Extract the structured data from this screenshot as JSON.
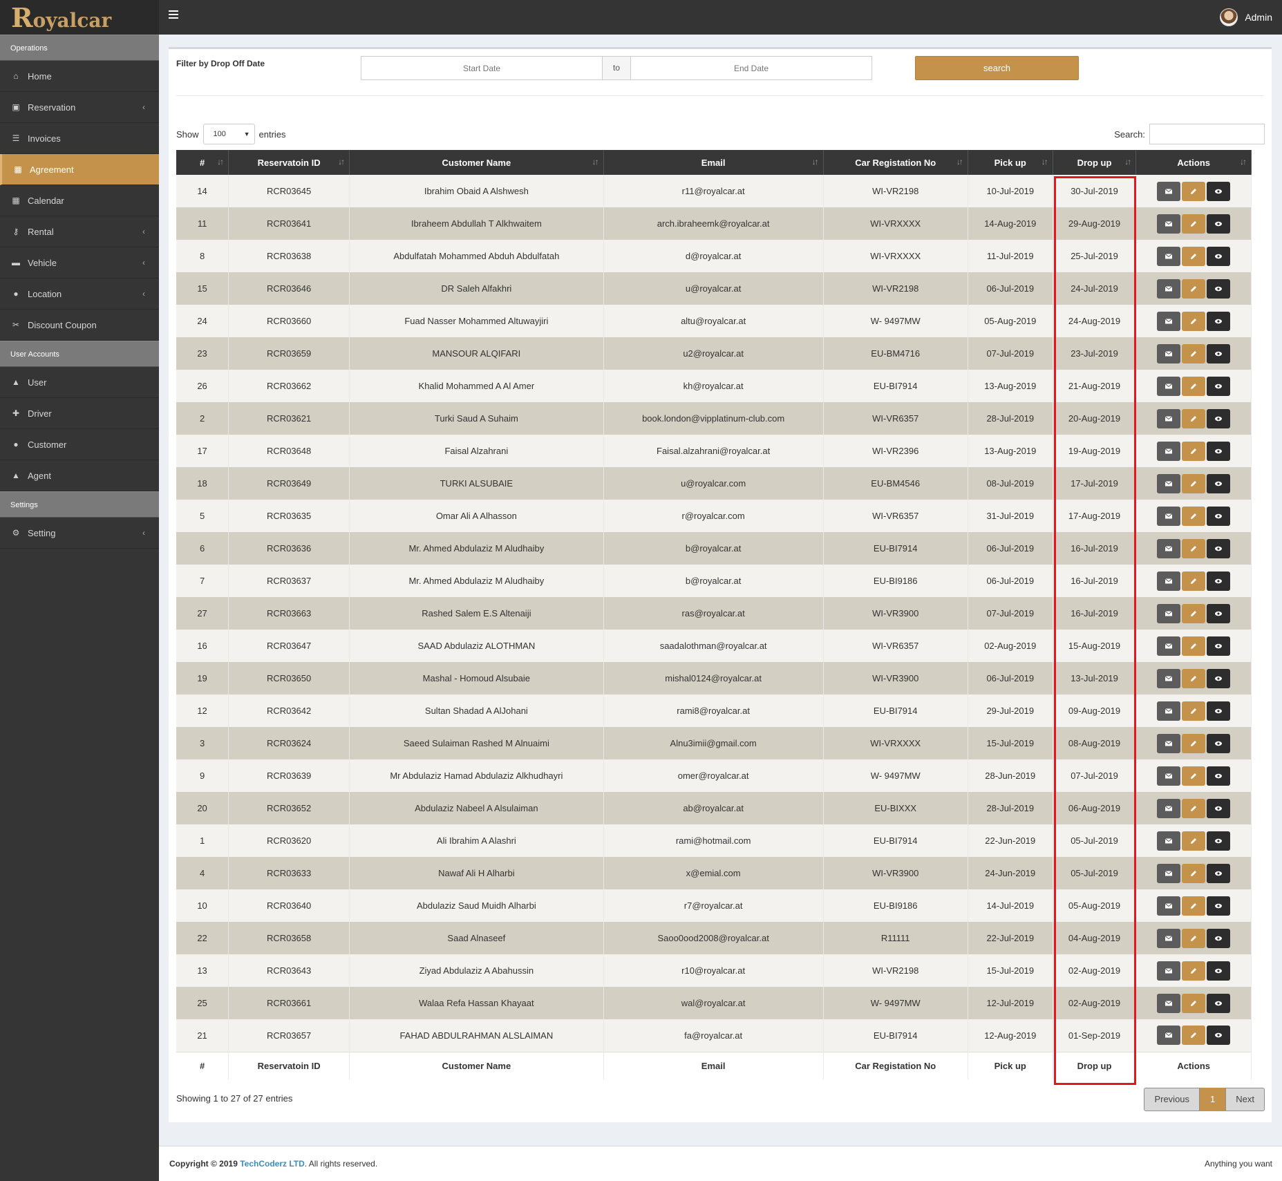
{
  "app": {
    "logo_text": "Royalcar",
    "user": "Admin"
  },
  "sidebar": {
    "sections": [
      {
        "header": "Operations",
        "items": [
          {
            "label": "Home",
            "icon": "home-icon",
            "chevron": false,
            "active": false
          },
          {
            "label": "Reservation",
            "icon": "calendar-check-icon",
            "chevron": true,
            "active": false
          },
          {
            "label": "Invoices",
            "icon": "list-icon",
            "chevron": false,
            "active": false
          },
          {
            "label": "Agreement",
            "icon": "grid-icon",
            "chevron": false,
            "active": true
          },
          {
            "label": "Calendar",
            "icon": "calendar-icon",
            "chevron": false,
            "active": false
          },
          {
            "label": "Rental",
            "icon": "key-icon",
            "chevron": true,
            "active": false
          },
          {
            "label": "Vehicle",
            "icon": "car-icon",
            "chevron": true,
            "active": false
          },
          {
            "label": "Location",
            "icon": "map-pin-icon",
            "chevron": true,
            "active": false
          },
          {
            "label": "Discount Coupon",
            "icon": "scissors-icon",
            "chevron": false,
            "active": false
          }
        ]
      },
      {
        "header": "User Accounts",
        "items": [
          {
            "label": "User",
            "icon": "user-lock-icon",
            "chevron": false,
            "active": false
          },
          {
            "label": "Driver",
            "icon": "user-plus-icon",
            "chevron": false,
            "active": false
          },
          {
            "label": "Customer",
            "icon": "users-icon",
            "chevron": false,
            "active": false
          },
          {
            "label": "Agent",
            "icon": "user-lock-icon",
            "chevron": false,
            "active": false
          }
        ]
      },
      {
        "header": "Settings",
        "items": [
          {
            "label": "Setting",
            "icon": "gears-icon",
            "chevron": true,
            "active": false
          }
        ]
      }
    ]
  },
  "filter": {
    "label": "Filter by Drop Off Date",
    "start_placeholder": "Start Date",
    "to_label": "to",
    "end_placeholder": "End Date",
    "search_label": "search"
  },
  "table_controls": {
    "show_label": "Show",
    "entries_value": "100",
    "entries_label": "entries",
    "search_label": "Search:"
  },
  "table": {
    "columns": [
      "#",
      "Reservatoin ID",
      "Customer Name",
      "Email",
      "Car Registation No",
      "Pick up",
      "Drop up",
      "Actions"
    ],
    "rows": [
      [
        "14",
        "RCR03645",
        "Ibrahim Obaid A Alshwesh",
        "r11@royalcar.at",
        "WI-VR2198",
        "10-Jul-2019",
        "30-Jul-2019"
      ],
      [
        "11",
        "RCR03641",
        "Ibraheem Abdullah T Alkhwaitem",
        "arch.ibraheemk@royalcar.at",
        "WI-VRXXXX",
        "14-Aug-2019",
        "29-Aug-2019"
      ],
      [
        "8",
        "RCR03638",
        "Abdulfatah Mohammed Abduh Abdulfatah",
        "d@royalcar.at",
        "WI-VRXXXX",
        "11-Jul-2019",
        "25-Jul-2019"
      ],
      [
        "15",
        "RCR03646",
        "DR Saleh Alfakhri",
        "u@royalcar.at",
        "WI-VR2198",
        "06-Jul-2019",
        "24-Jul-2019"
      ],
      [
        "24",
        "RCR03660",
        "Fuad Nasser Mohammed Altuwayjiri",
        "altu@royalcar.at",
        "W- 9497MW",
        "05-Aug-2019",
        "24-Aug-2019"
      ],
      [
        "23",
        "RCR03659",
        "MANSOUR ALQIFARI",
        "u2@royalcar.at",
        "EU-BM4716",
        "07-Jul-2019",
        "23-Jul-2019"
      ],
      [
        "26",
        "RCR03662",
        "Khalid Mohammed A Al Amer",
        "kh@royalcar.at",
        "EU-BI7914",
        "13-Aug-2019",
        "21-Aug-2019"
      ],
      [
        "2",
        "RCR03621",
        "Turki Saud A Suhaim",
        "book.london@vipplatinum-club.com",
        "WI-VR6357",
        "28-Jul-2019",
        "20-Aug-2019"
      ],
      [
        "17",
        "RCR03648",
        "Faisal Alzahrani",
        "Faisal.alzahrani@royalcar.at",
        "WI-VR2396",
        "13-Aug-2019",
        "19-Aug-2019"
      ],
      [
        "18",
        "RCR03649",
        "TURKI ALSUBAIE",
        "u@royalcar.com",
        "EU-BM4546",
        "08-Jul-2019",
        "17-Jul-2019"
      ],
      [
        "5",
        "RCR03635",
        "Omar Ali A Alhasson",
        "r@royalcar.com",
        "WI-VR6357",
        "31-Jul-2019",
        "17-Aug-2019"
      ],
      [
        "6",
        "RCR03636",
        "Mr. Ahmed Abdulaziz M Aludhaiby",
        "b@royalcar.at",
        "EU-BI7914",
        "06-Jul-2019",
        "16-Jul-2019"
      ],
      [
        "7",
        "RCR03637",
        "Mr. Ahmed Abdulaziz M Aludhaiby",
        "b@royalcar.at",
        "EU-BI9186",
        "06-Jul-2019",
        "16-Jul-2019"
      ],
      [
        "27",
        "RCR03663",
        "Rashed Salem E.S Altenaiji",
        "ras@royalcar.at",
        "WI-VR3900",
        "07-Jul-2019",
        "16-Jul-2019"
      ],
      [
        "16",
        "RCR03647",
        "SAAD Abdulaziz ALOTHMAN",
        "saadalothman@royalcar.at",
        "WI-VR6357",
        "02-Aug-2019",
        "15-Aug-2019"
      ],
      [
        "19",
        "RCR03650",
        "Mashal - Homoud Alsubaie",
        "mishal0124@royalcar.at",
        "WI-VR3900",
        "06-Jul-2019",
        "13-Jul-2019"
      ],
      [
        "12",
        "RCR03642",
        "Sultan Shadad A AlJohani",
        "rami8@royalcar.at",
        "EU-BI7914",
        "29-Jul-2019",
        "09-Aug-2019"
      ],
      [
        "3",
        "RCR03624",
        "Saeed Sulaiman Rashed M Alnuaimi",
        "Alnu3imii@gmail.com",
        "WI-VRXXXX",
        "15-Jul-2019",
        "08-Aug-2019"
      ],
      [
        "9",
        "RCR03639",
        "Mr Abdulaziz Hamad Abdulaziz Alkhudhayri",
        "omer@royalcar.at",
        "W- 9497MW",
        "28-Jun-2019",
        "07-Jul-2019"
      ],
      [
        "20",
        "RCR03652",
        "Abdulaziz Nabeel A Alsulaiman",
        "ab@royalcar.at",
        "EU-BIXXX",
        "28-Jul-2019",
        "06-Aug-2019"
      ],
      [
        "1",
        "RCR03620",
        "Ali Ibrahim A Alashri",
        "rami@hotmail.com",
        "EU-BI7914",
        "22-Jun-2019",
        "05-Jul-2019"
      ],
      [
        "4",
        "RCR03633",
        "Nawaf Ali H Alharbi",
        "x@emial.com",
        "WI-VR3900",
        "24-Jun-2019",
        "05-Jul-2019"
      ],
      [
        "10",
        "RCR03640",
        "Abdulaziz Saud Muidh Alharbi",
        "r7@royalcar.at",
        "EU-BI9186",
        "14-Jul-2019",
        "05-Aug-2019"
      ],
      [
        "22",
        "RCR03658",
        "Saad Alnaseef",
        "Saoo0ood2008@royalcar.at",
        "R11111",
        "22-Jul-2019",
        "04-Aug-2019"
      ],
      [
        "13",
        "RCR03643",
        "Ziyad Abdulaziz A Abahussin",
        "r10@royalcar.at",
        "WI-VR2198",
        "15-Jul-2019",
        "02-Aug-2019"
      ],
      [
        "25",
        "RCR03661",
        "Walaa Refa Hassan Khayaat",
        "wal@royalcar.at",
        "W- 9497MW",
        "12-Jul-2019",
        "02-Aug-2019"
      ],
      [
        "21",
        "RCR03657",
        "FAHAD ABDULRAHMAN ALSLAIMAN",
        "fa@royalcar.at",
        "EU-BI7914",
        "12-Aug-2019",
        "01-Sep-2019"
      ]
    ]
  },
  "pagination": {
    "showing": "Showing 1 to 27 of 27 entries",
    "previous": "Previous",
    "page": "1",
    "next": "Next"
  },
  "footer": {
    "copyright_prefix": "Copyright © 2019",
    "company": "TechCoderz LTD",
    "rights": ". All rights reserved.",
    "tagline": "Anything you want"
  },
  "colors": {
    "accent": "#c4924a",
    "dark": "#343434",
    "highlight_border": "#e4171f"
  }
}
